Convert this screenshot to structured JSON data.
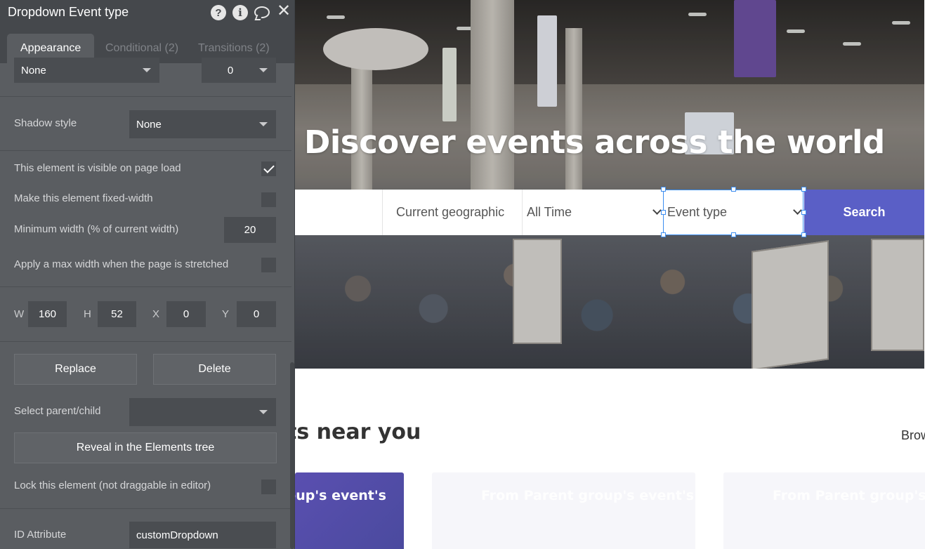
{
  "panel": {
    "title": "Dropdown Event type",
    "header_icons": [
      "help-icon",
      "info-icon",
      "comment-icon",
      "close-icon"
    ],
    "help_glyph": "?",
    "info_glyph": "i",
    "close_glyph": "✕",
    "tabs": [
      {
        "label": "Appearance",
        "active": true
      },
      {
        "label": "Conditional (2)",
        "active": false
      },
      {
        "label": "Transitions (2)",
        "active": false
      }
    ],
    "border_style_value": "None",
    "border_width_value": "0",
    "shadow_style": {
      "label": "Shadow style",
      "value": "None"
    },
    "visible_on_load": {
      "label": "This element is visible on page load",
      "checked": true
    },
    "fixed_width": {
      "label": "Make this element fixed-width",
      "checked": false
    },
    "min_width": {
      "label": "Minimum width (% of current width)",
      "value": "20"
    },
    "max_width": {
      "label": "Apply a max width when the page is stretched",
      "checked": false
    },
    "dimensions": {
      "w_label": "W",
      "w": "160",
      "h_label": "H",
      "h": "52",
      "x_label": "X",
      "x": "0",
      "y_label": "Y",
      "y": "0"
    },
    "replace_label": "Replace",
    "delete_label": "Delete",
    "select_parent": {
      "label": "Select parent/child",
      "value": ""
    },
    "reveal_label": "Reveal in the Elements tree",
    "lock": {
      "label": "Lock this element (not draggable in editor)",
      "checked": false
    },
    "id_attribute": {
      "label": "ID Attribute",
      "value": "customDropdown"
    }
  },
  "canvas": {
    "hero_title": "Discover events across the world",
    "search": {
      "location_placeholder": "Current geographic",
      "time_value": "All Time",
      "type_value": "Event type",
      "button_label": "Search"
    },
    "section_title": "ts near you",
    "browse_label": "Brow",
    "cards": [
      {
        "label": "oup's event's"
      },
      {
        "label": "From Parent group's event's"
      },
      {
        "label": "From Parent group's e"
      }
    ],
    "colors": {
      "accent": "#5a5fc6",
      "selection": "#3c8df0",
      "panel_bg": "#5a5d61",
      "panel_header": "#45484c"
    }
  }
}
